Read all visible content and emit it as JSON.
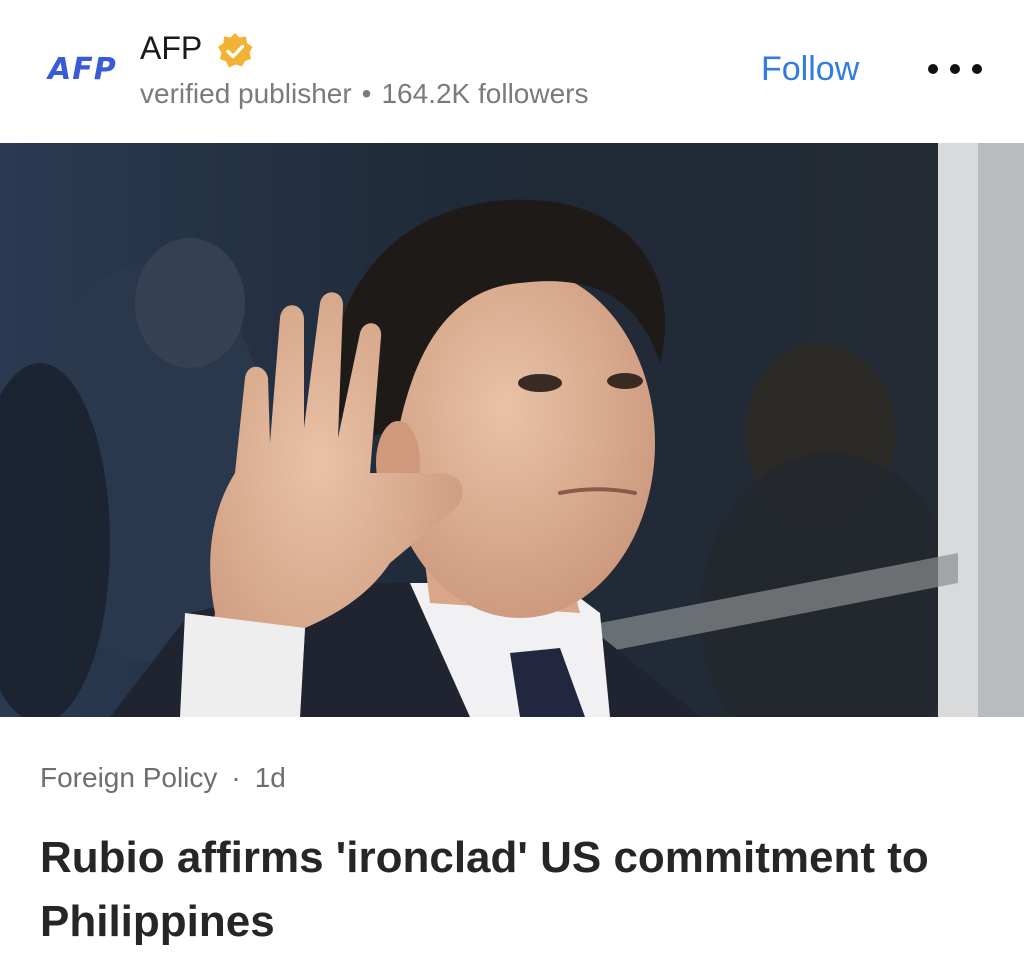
{
  "publisher": {
    "logo_text": "AFP",
    "name": "AFP",
    "verified_icon": "verified-badge-icon",
    "subtitle": "verified publisher",
    "followers": "164.2K followers",
    "follow_label": "Follow",
    "more_icon": "more-dots-icon"
  },
  "article": {
    "image_description_icon": "article-photo",
    "category": "Foreign Policy",
    "age": "1d",
    "headline": "Rubio affirms 'ironclad' US commitment to Philippines"
  },
  "colors": {
    "accent": "#2f7de1",
    "logo": "#3a5bd9",
    "verified_badge": "#f2b233"
  }
}
